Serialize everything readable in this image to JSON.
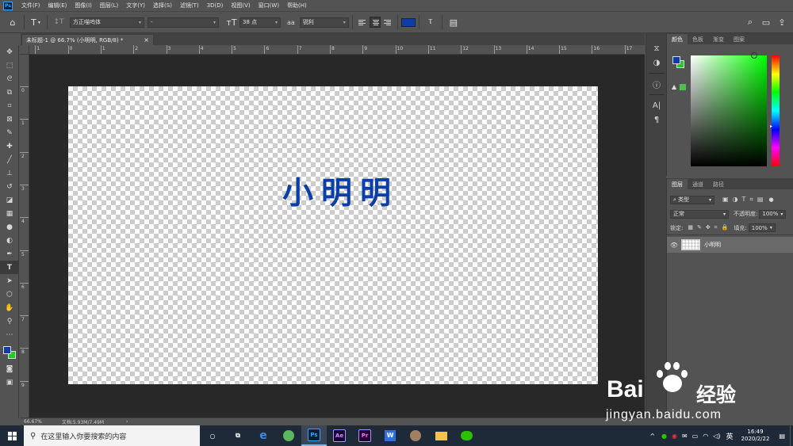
{
  "menubar": {
    "items": [
      "文件(F)",
      "编辑(E)",
      "图像(I)",
      "图层(L)",
      "文字(Y)",
      "选择(S)",
      "滤镜(T)",
      "3D(D)",
      "视图(V)",
      "窗口(W)",
      "帮助(H)"
    ]
  },
  "options": {
    "tool_letter": "T",
    "font_family": "方正喵呜体",
    "font_style": "-",
    "font_size": "38 点",
    "aa_label": "aa",
    "antialias": "锐利",
    "text_color": "#0b3ea8"
  },
  "document": {
    "tab_title": "未标题-1 @ 66.7% (小明明, RGB/8) *",
    "tab_close": "×",
    "text": "小明明",
    "text_color": "#0b3ea8"
  },
  "rulers": {
    "h_labels": [
      "1",
      "0",
      "1",
      "2",
      "3",
      "4",
      "5",
      "6",
      "7",
      "8",
      "9",
      "10",
      "11",
      "12",
      "13",
      "14",
      "15",
      "16",
      "17"
    ],
    "v_labels": [
      "0",
      "1",
      "2",
      "3",
      "4",
      "5",
      "6",
      "7",
      "8",
      "9"
    ]
  },
  "status": {
    "zoom": "66.67%",
    "doc_info": "文档:5.93M/7.49M",
    "arrow": "›"
  },
  "color_panel": {
    "tabs": [
      "颜色",
      "色板",
      "渐变",
      "图案"
    ],
    "foreground": "#0b3ea8",
    "background": "#22cc22"
  },
  "layers_panel": {
    "tabs": [
      "图层",
      "通道",
      "路径"
    ],
    "filter": "类型",
    "blend_mode": "正常",
    "opacity_label": "不透明度:",
    "opacity_value": "100%",
    "lock_label": "锁定:",
    "fill_label": "填充:",
    "fill_value": "100%",
    "layer_name": "小明明"
  },
  "taskbar": {
    "search_placeholder": "在这里输入你要搜索的内容",
    "apps": [
      "Ps",
      "Ae",
      "Pr"
    ],
    "ime": "英",
    "time": "16:49",
    "date": "2020/2/22"
  },
  "watermark": {
    "brand": "Bai",
    "brand2": "经验",
    "url": "jingyan.baidu.com"
  }
}
